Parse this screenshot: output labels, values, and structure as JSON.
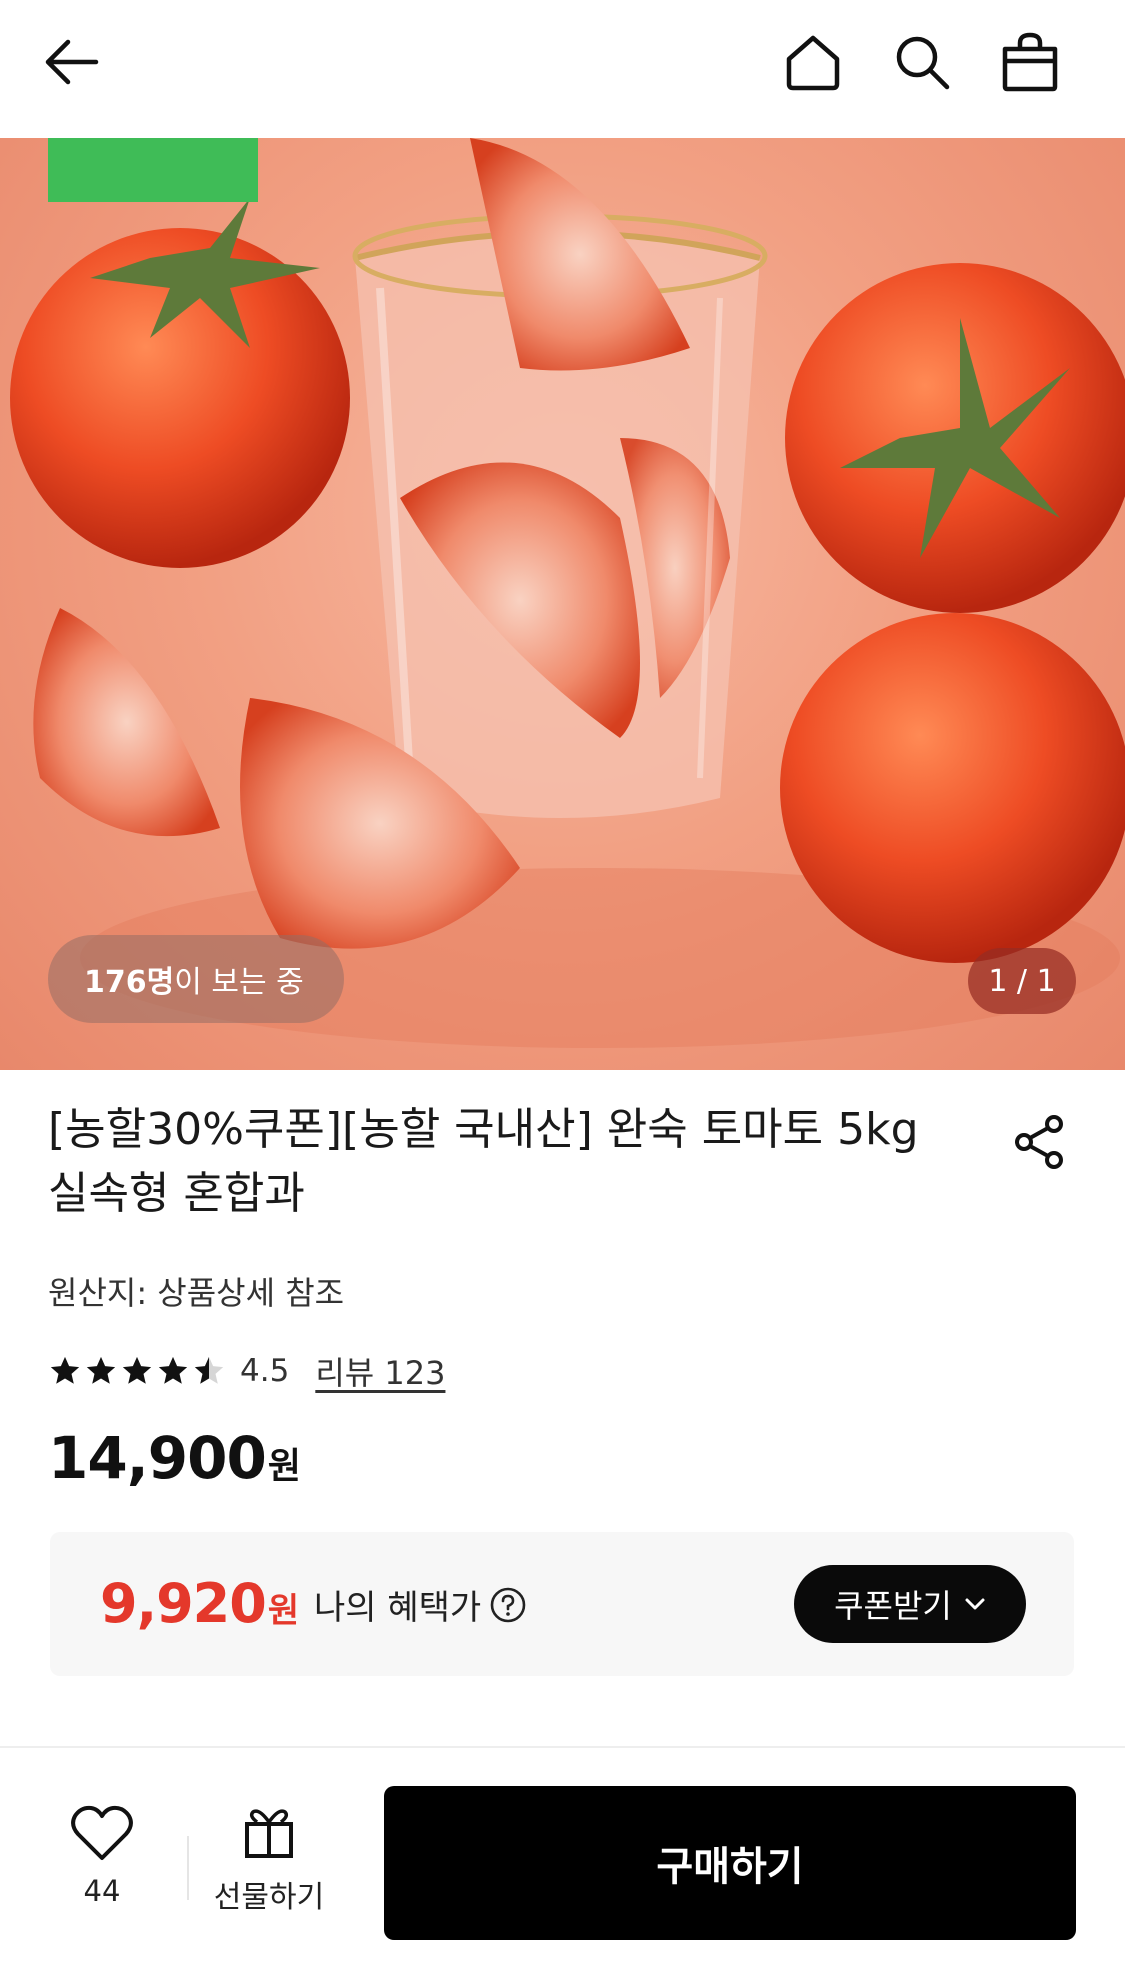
{
  "header": {
    "back_icon": "arrow-left-icon",
    "home_icon": "home-icon",
    "search_icon": "search-icon",
    "cart_icon": "shopping-bag-icon"
  },
  "hero": {
    "viewer_count": "176명",
    "viewer_suffix": "이 보는 중",
    "pager": "1 / 1"
  },
  "product": {
    "title": "[농할30%쿠폰][농할 국내산] 완숙 토마토 5kg 실속형 혼합과",
    "origin": "원산지: 상품상세 참조",
    "rating": "4.5",
    "rating_fraction": 0.9,
    "review_link": "리뷰 123",
    "price_number": "14,900",
    "price_unit": "원"
  },
  "benefit": {
    "price_number": "9,920",
    "price_unit": "원",
    "label": "나의 혜택가",
    "coupon_button": "쿠폰받기"
  },
  "bottom_bar": {
    "like_count": "44",
    "gift_label": "선물하기",
    "buy_button": "구매하기"
  },
  "colors": {
    "accent_red": "#e4382b",
    "badge_green": "#3fbc57",
    "button_black": "#000000"
  }
}
